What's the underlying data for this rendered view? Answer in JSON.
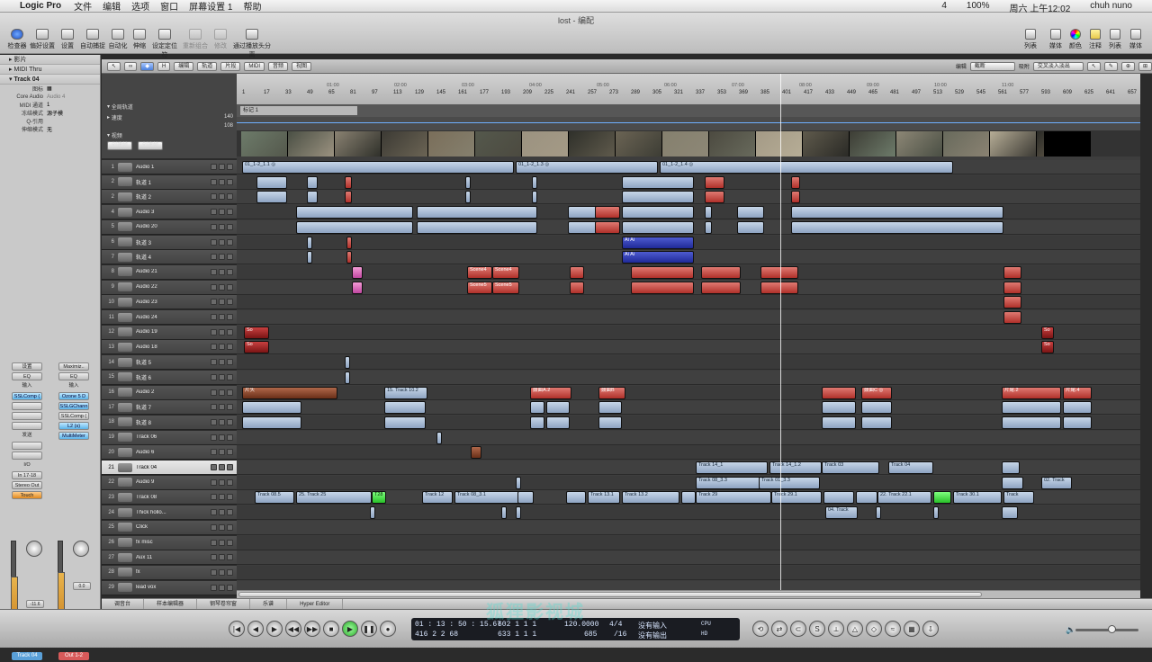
{
  "menubar": {
    "app": "Logic Pro",
    "items": [
      "文件",
      "编辑",
      "选项",
      "窗口",
      "屏幕设置 1",
      "帮助"
    ],
    "right": [
      "4",
      "100%",
      "周六 上午12:02",
      "chuh nuno"
    ]
  },
  "window": {
    "title": "lost - 编配"
  },
  "toolbar": {
    "left": [
      "检查器",
      "偏好设置",
      "设置",
      "自动捕捉",
      "自动化",
      "伸缩",
      "设定定位符",
      "重新组合",
      "修改",
      "通过播放头分离"
    ],
    "right": [
      "列表",
      "媒体",
      "颜色",
      "注释",
      "列表",
      "媒体"
    ]
  },
  "inspector": {
    "rows": [
      "影片",
      "MIDI Thru",
      "Track 04"
    ],
    "kv": [
      [
        "图标",
        ""
      ],
      [
        "Core Audio",
        "Audio 4"
      ],
      [
        "MIDI 通道",
        "1"
      ],
      [
        "冻结模式",
        "源子模"
      ],
      [
        "Q-引用",
        ""
      ],
      [
        "伸缩模式",
        "无"
      ]
    ]
  },
  "strips": [
    {
      "setting": "设置",
      "eq": "EQ",
      "in": "输入",
      "inserts": [
        "SSLComp (",
        "",
        "",
        "",
        "",
        ""
      ],
      "sends": "发送",
      "io": "In 17-18",
      "out": "Stereo Out",
      "auto": "Touch",
      "name": "Track 04",
      "value": "-11.6",
      "pan": ""
    },
    {
      "setting": "Maximiz..",
      "eq": "EQ",
      "in": "输入",
      "inserts": [
        "Ozone 5 D",
        "SSLGChann",
        "SSLComp (",
        "L2 (s)",
        "MultiMeter"
      ],
      "sends": "",
      "io": "",
      "out": "",
      "auto": "",
      "name": "Out 1-2",
      "value": "0.0",
      "pan": ""
    }
  ],
  "globals": [
    "全局轨道",
    "速度",
    "视频"
  ],
  "globals_btns": [
    "创建帧",
    "创建帧"
  ],
  "trtoolbar": [
    "编辑",
    "轨道",
    "片段",
    "MIDI",
    "音频",
    "视图",
    "编辑",
    "截断",
    "吸附",
    "交叉淡入淡出"
  ],
  "ruler": {
    "bars": [
      "1",
      "17",
      "33",
      "49",
      "65",
      "81",
      "97",
      "113",
      "129",
      "145",
      "161",
      "177",
      "193",
      "209",
      "225",
      "241",
      "257",
      "273",
      "289",
      "305",
      "321",
      "337",
      "353",
      "369",
      "385",
      "401",
      "417",
      "433",
      "449",
      "465",
      "481",
      "497",
      "513",
      "529",
      "545",
      "561",
      "577",
      "593",
      "609",
      "625",
      "641",
      "657"
    ],
    "times": [
      "01:00",
      "02:00",
      "03:00",
      "04:00",
      "05:00",
      "06:00",
      "07:00",
      "08:00",
      "09:00",
      "10:00",
      "11:00"
    ]
  },
  "marker": "标记 1",
  "tempo": {
    "value": "140",
    "label2": "108"
  },
  "tracks": [
    {
      "n": "1",
      "name": "Audio 1"
    },
    {
      "n": "2",
      "name": "轨道 1"
    },
    {
      "n": "2",
      "name": "轨道 2"
    },
    {
      "n": "4",
      "name": "Audio 3"
    },
    {
      "n": "5",
      "name": "Audio 20"
    },
    {
      "n": "6",
      "name": "轨道 3"
    },
    {
      "n": "7",
      "name": "轨道 4"
    },
    {
      "n": "8",
      "name": "Audio 21"
    },
    {
      "n": "9",
      "name": "Audio 22"
    },
    {
      "n": "10",
      "name": "Audio 23"
    },
    {
      "n": "11",
      "name": "Audio 24"
    },
    {
      "n": "12",
      "name": "Audio 19"
    },
    {
      "n": "13",
      "name": "Audio 18"
    },
    {
      "n": "14",
      "name": "轨道 5"
    },
    {
      "n": "15",
      "name": "轨道 6"
    },
    {
      "n": "16",
      "name": "Audio 2"
    },
    {
      "n": "17",
      "name": "轨道 7"
    },
    {
      "n": "18",
      "name": "轨道 8"
    },
    {
      "n": "19",
      "name": "Track 06"
    },
    {
      "n": "20",
      "name": "Audio 6"
    },
    {
      "n": "21",
      "name": "Track 04"
    },
    {
      "n": "22",
      "name": "Audio 9"
    },
    {
      "n": "23",
      "name": "Track 08"
    },
    {
      "n": "24",
      "name": "Thick hollo..."
    },
    {
      "n": "25",
      "name": "Click"
    },
    {
      "n": "26",
      "name": "fx misc"
    },
    {
      "n": "27",
      "name": "Aux 11"
    },
    {
      "n": "28",
      "name": "fx"
    },
    {
      "n": "29",
      "name": "lead vox"
    }
  ],
  "bottombar": [
    "调音台",
    "样本编辑器",
    "钢琴卷帘窗",
    "乐谱",
    "Hyper Editor"
  ],
  "transport": {
    "smpte": "01 : 13 : 50 : 15.67",
    "smpte2": "416    2    2    68",
    "bars": "602    1    1    1",
    "bars2": "633    1    1    1",
    "tempo": "120.0000",
    "tempo2": "685",
    "sig": "4/4",
    "sig2": "/16",
    "in": "没有输入",
    "out": "没有输出",
    "cpu": "CPU",
    "hd": "HD"
  },
  "regions": [
    {
      "l": 0,
      "t": "01_1-2_1.1 ◎"
    },
    {
      "l": 0,
      "t": "01_1-2_1.3 ◎"
    },
    {
      "l": 0,
      "t": "01_1-2_1.4 ◎"
    },
    {
      "l": 7,
      "t": "Scene4"
    },
    {
      "l": 7,
      "t": "Scene4"
    },
    {
      "l": 8,
      "t": "Scene5"
    },
    {
      "l": 8,
      "t": "Scene5"
    },
    {
      "l": 15,
      "t": "片头"
    },
    {
      "l": 15,
      "t": "15. Track 10.2"
    },
    {
      "l": 15,
      "t": "鼓曲A.2"
    },
    {
      "l": 15,
      "t": "鼓曲B"
    },
    {
      "l": 15,
      "t": "鼓曲C ◎"
    },
    {
      "l": 15,
      "t": "片尾.2"
    },
    {
      "l": 15,
      "t": "片尾.4"
    },
    {
      "l": 20,
      "t": "Track 14_1"
    },
    {
      "l": 20,
      "t": "Track 14_1.2"
    },
    {
      "l": 20,
      "t": "Track 03"
    },
    {
      "l": 20,
      "t": "Track 04"
    },
    {
      "l": 22,
      "t": "Track 08.5"
    },
    {
      "l": 22,
      "t": "25. Track 25"
    },
    {
      "l": 22,
      "t": "Track 12"
    },
    {
      "l": 22,
      "t": "Track 08_3.1"
    },
    {
      "l": 22,
      "t": "Track 13.1"
    },
    {
      "l": 22,
      "t": "Track 13.2"
    },
    {
      "l": 22,
      "t": "Track 29"
    },
    {
      "l": 22,
      "t": "Track 29.1"
    },
    {
      "l": 22,
      "t": "22. Track 22.1"
    },
    {
      "l": 22,
      "t": "Track 30.1"
    },
    {
      "l": 22,
      "t": "Track"
    },
    {
      "l": 21,
      "t": "Track 08_3.3"
    },
    {
      "l": 21,
      "t": "Track 01_3.3"
    },
    {
      "l": 21,
      "t": "02. Track"
    },
    {
      "l": 23,
      "t": "04. Track"
    }
  ],
  "watermark": "狐狸影视城"
}
